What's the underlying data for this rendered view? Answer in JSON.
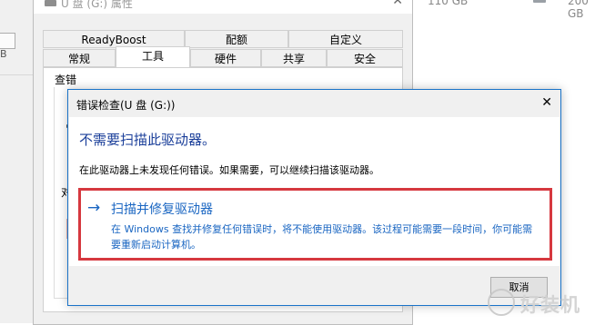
{
  "background": {
    "left_stub_letter": "B",
    "drive_size_a": "110 GB",
    "drive_size_b": "200 GB"
  },
  "properties_window": {
    "title": "U 盘 (G:) 属性",
    "tabs_row1": [
      "ReadyBoost",
      "配额",
      "自定义"
    ],
    "tabs_row2": [
      "常规",
      "工具",
      "硬件",
      "共享",
      "安全"
    ],
    "active_tab": "工具",
    "panel_label_partial": "查错",
    "panel_label_partial2": "对"
  },
  "error_check_dialog": {
    "title": "错误检查(U 盘 (G:))",
    "heading": "不需要扫描此驱动器。",
    "description": "在此驱动器上未发现任何错误。如果需要，可以继续扫描该驱动器。",
    "scan_option": {
      "title": "扫描并修复驱动器",
      "description": "在 Windows 查找并修复任何错误时，将不能使用驱动器。该过程可能需要一段时间，你可能需要重新启动计算机。"
    },
    "cancel_label": "取消"
  },
  "watermark": {
    "text": "好装机"
  },
  "colors": {
    "accent_blue": "#1a66c2",
    "highlight_red": "#d6383f",
    "heading_blue": "#1b3f9a"
  }
}
